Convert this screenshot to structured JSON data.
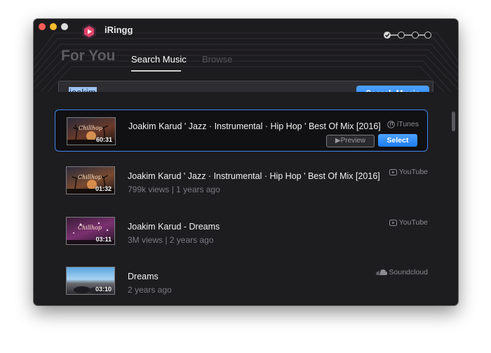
{
  "app": {
    "title": "iRingg"
  },
  "header": {
    "for_you": "For You",
    "tabs": [
      {
        "label": "Search Music",
        "active": true
      },
      {
        "label": "Browse",
        "active": false
      }
    ]
  },
  "search": {
    "query": "joakim",
    "button_label": "Search Music"
  },
  "results": [
    {
      "title": "Joakim Karud ' Jazz · Instrumental · Hip Hop ' Best Of Mix [2016]",
      "meta": "",
      "source": "iTunes",
      "source_icon": "music-note-icon",
      "duration": "60:31",
      "thumb_text": "Chillhop",
      "selected": true,
      "preview_label": "Preview",
      "select_label": "Select"
    },
    {
      "title": "Joakim Karud ' Jazz · Instrumental · Hip Hop ' Best Of Mix [2016]",
      "meta": "799k views | 1 years ago",
      "source": "YouTube",
      "source_icon": "youtube-icon",
      "duration": "01:32",
      "thumb_text": "Chillhop"
    },
    {
      "title": "Joakim Karud - Dreams",
      "meta": "3M views | 2 years ago",
      "source": "YouTube",
      "source_icon": "youtube-icon",
      "duration": "03:11",
      "thumb_text": "Chillhop"
    },
    {
      "title": "Dreams",
      "meta": "2 years ago",
      "source": "Soundcloud",
      "source_icon": "soundcloud-icon",
      "duration": "03:10",
      "thumb_text": ""
    }
  ],
  "colors": {
    "accent": "#1c7cf0",
    "background": "#1d1c1f",
    "selected_border": "#3b86f0"
  }
}
